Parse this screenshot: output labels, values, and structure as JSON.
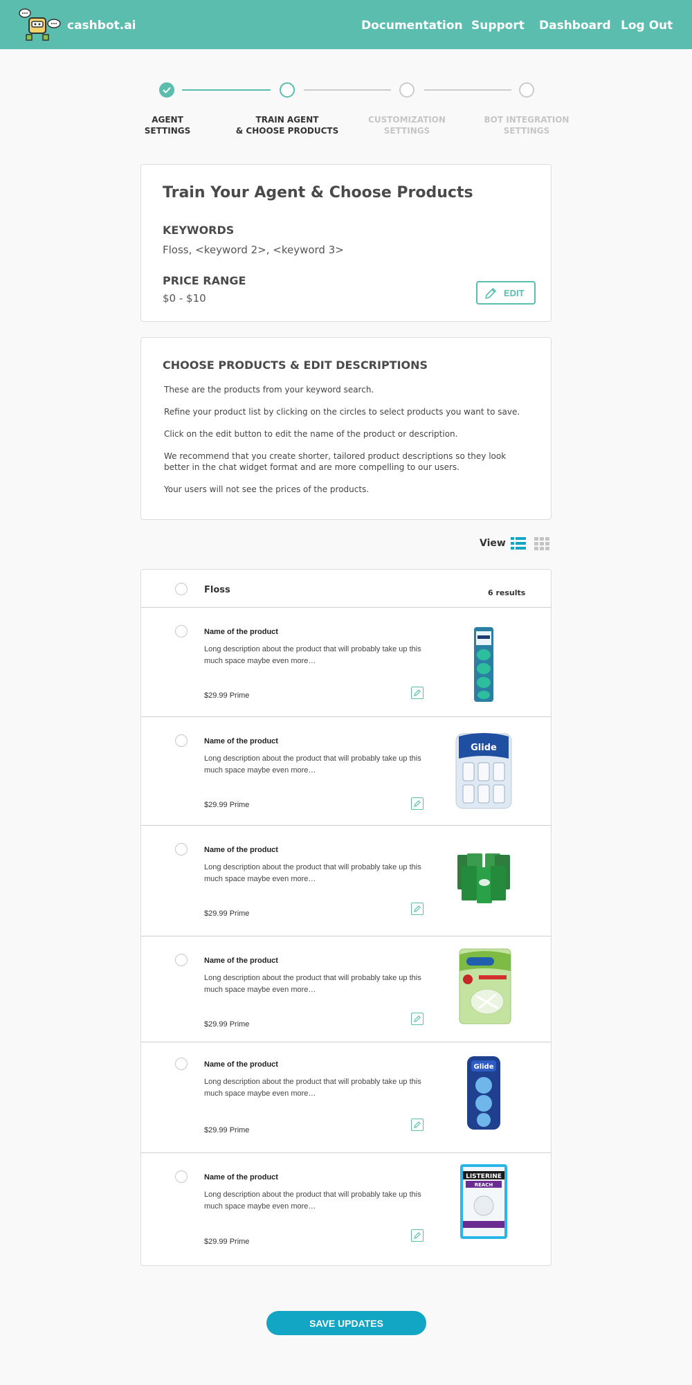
{
  "header": {
    "brand": "cashbot.ai",
    "nav": [
      "Documentation",
      "Support",
      "Dashboard",
      "Log Out"
    ],
    "colors": {
      "header_bg": "#5bbdad",
      "accent": "#5bbdad",
      "primary_button": "#13a6c4"
    }
  },
  "stepper": {
    "steps": [
      {
        "line1": "AGENT",
        "line2": "SETTINGS",
        "state": "done"
      },
      {
        "line1": "TRAIN AGENT",
        "line2": "& CHOOSE PRODUCTS",
        "state": "active"
      },
      {
        "line1": "CUSTOMIZATION",
        "line2": "SETTINGS",
        "state": "todo"
      },
      {
        "line1": "BOT INTEGRATION",
        "line2": "SETTINGS",
        "state": "todo"
      }
    ]
  },
  "train_card": {
    "title": "Train Your Agent & Choose Products",
    "keywords_label": "KEYWORDS",
    "keywords_value": "Floss, <keyword 2>, <keyword 3>",
    "price_label": "PRICE RANGE",
    "price_value": "$0 - $10",
    "edit_label": "EDIT"
  },
  "instructions": {
    "title": "CHOOSE PRODUCTS & EDIT DESCRIPTIONS",
    "p1": "These are the products from your keyword search.",
    "p2": "Refine your product list by clicking on the circles to select products you want to save.",
    "p3": "Click on the edit button to edit the name of the product or description.",
    "p4": "We recommend that you create shorter, tailored product descriptions so they look better in the chat widget format and are more compelling to our users.",
    "p5": "Your users will not see the prices of the products."
  },
  "view": {
    "label": "View",
    "modes": [
      "list-view-icon",
      "grid-view-icon"
    ],
    "selected": "list"
  },
  "product_list": {
    "keyword": "Floss",
    "count": "6 results",
    "products": [
      {
        "name": "Name of the product",
        "description": "Long description about the product that will probably take up this much space maybe even more…",
        "price": "$29.99 Prime",
        "image": "floss-picks-pack"
      },
      {
        "name": "Name of the product",
        "description": "Long description about the product that will probably take up this much space maybe even more…",
        "price": "$29.99 Prime",
        "image": "glide-floss-multipack"
      },
      {
        "name": "Name of the product",
        "description": "Long description about the product that will probably take up this much space maybe even more…",
        "price": "$29.99 Prime",
        "image": "green-floss-packs"
      },
      {
        "name": "Name of the product",
        "description": "Long description about the product that will probably take up this much space maybe even more…",
        "price": "$29.99 Prime",
        "image": "dentek-triple-clean-bag"
      },
      {
        "name": "Name of the product",
        "description": "Long description about the product that will probably take up this much space maybe even more…",
        "price": "$29.99 Prime",
        "image": "glide-floss-picks-blue"
      },
      {
        "name": "Name of the product",
        "description": "Long description about the product that will probably take up this much space maybe even more…",
        "price": "$29.99 Prime",
        "image": "listerine-reach-floss"
      }
    ]
  },
  "save_button": "SAVE UPDATES"
}
